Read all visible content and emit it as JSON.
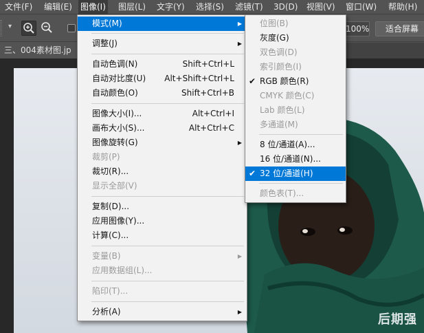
{
  "menubar": {
    "items": [
      "文件(F)",
      "编辑(E)",
      "图像(I)",
      "图层(L)",
      "文字(Y)",
      "选择(S)",
      "滤镜(T)",
      "3D(D)",
      "视图(V)",
      "窗口(W)",
      "帮助(H)"
    ],
    "active": "图像(I)"
  },
  "options_bar": {
    "zoom_value": "100%",
    "fit_screen": "适合屏幕",
    "icons": [
      "zoom-in-icon",
      "zoom-out-icon"
    ]
  },
  "document_tab": {
    "title": "三、004素材图.jp"
  },
  "watermark": "后期强",
  "image_menu": {
    "items": [
      {
        "label": "模式(M)",
        "submenu": true,
        "highlighted": true
      },
      {
        "label": "调整(J)",
        "submenu": true
      },
      {
        "label": "自动色调(N)",
        "shortcut": "Shift+Ctrl+L"
      },
      {
        "label": "自动对比度(U)",
        "shortcut": "Alt+Shift+Ctrl+L"
      },
      {
        "label": "自动颜色(O)",
        "shortcut": "Shift+Ctrl+B"
      },
      {
        "label": "图像大小(I)...",
        "shortcut": "Alt+Ctrl+I"
      },
      {
        "label": "画布大小(S)...",
        "shortcut": "Alt+Ctrl+C"
      },
      {
        "label": "图像旋转(G)",
        "submenu": true
      },
      {
        "label": "裁剪(P)",
        "disabled": true
      },
      {
        "label": "裁切(R)..."
      },
      {
        "label": "显示全部(V)",
        "disabled": true
      },
      {
        "label": "复制(D)..."
      },
      {
        "label": "应用图像(Y)..."
      },
      {
        "label": "计算(C)..."
      },
      {
        "label": "变量(B)",
        "submenu": true,
        "disabled": true
      },
      {
        "label": "应用数据组(L)...",
        "disabled": true
      },
      {
        "label": "陷印(T)...",
        "disabled": true
      },
      {
        "label": "分析(A)",
        "submenu": true
      }
    ]
  },
  "mode_submenu": {
    "items": [
      {
        "label": "位图(B)",
        "disabled": true
      },
      {
        "label": "灰度(G)"
      },
      {
        "label": "双色调(D)",
        "disabled": true
      },
      {
        "label": "索引颜色(I)",
        "disabled": true
      },
      {
        "label": "RGB 颜色(R)",
        "checked": true
      },
      {
        "label": "CMYK 颜色(C)",
        "disabled": true
      },
      {
        "label": "Lab 颜色(L)",
        "disabled": true
      },
      {
        "label": "多通道(M)",
        "disabled": true
      },
      {
        "label": "8 位/通道(A)..."
      },
      {
        "label": "16 位/通道(N)..."
      },
      {
        "label": "32 位/通道(H)",
        "checked": true,
        "highlighted": true
      },
      {
        "label": "颜色表(T)...",
        "disabled": true
      }
    ]
  },
  "colors": {
    "ui_bg": "#535353",
    "menu_bg": "#f2f2f2",
    "highlight": "#0078d7",
    "scarf": "#1d5a4a",
    "skin": "#2a1e18"
  }
}
